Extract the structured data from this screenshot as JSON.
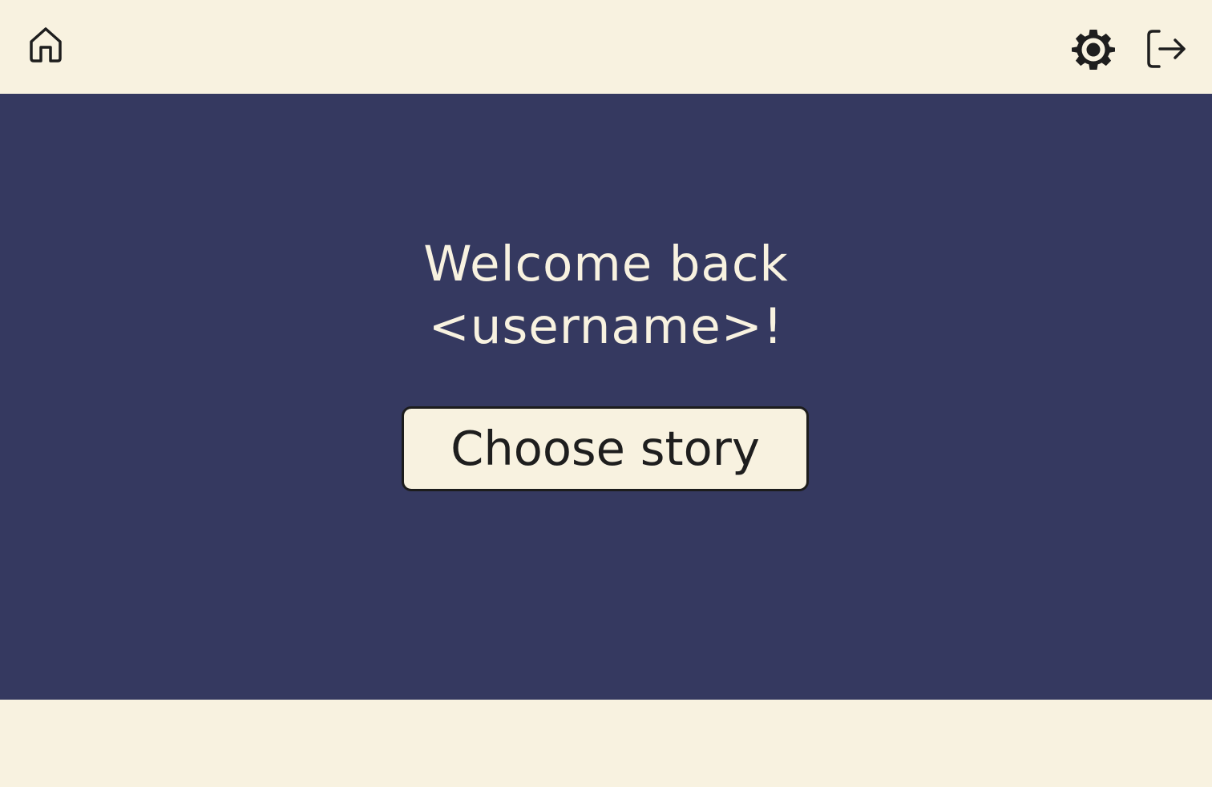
{
  "header": {
    "home_icon": "home-icon",
    "settings_icon": "gear-icon",
    "logout_icon": "logout-icon"
  },
  "main": {
    "welcome_line1": "Welcome back",
    "welcome_line2": "<username>!",
    "choose_story_label": "Choose story"
  },
  "colors": {
    "background": "#f8f2e0",
    "hero_background": "#353960",
    "text_light": "#f8f2e0",
    "text_dark": "#1e1e1e",
    "border": "#1c1c1c"
  }
}
